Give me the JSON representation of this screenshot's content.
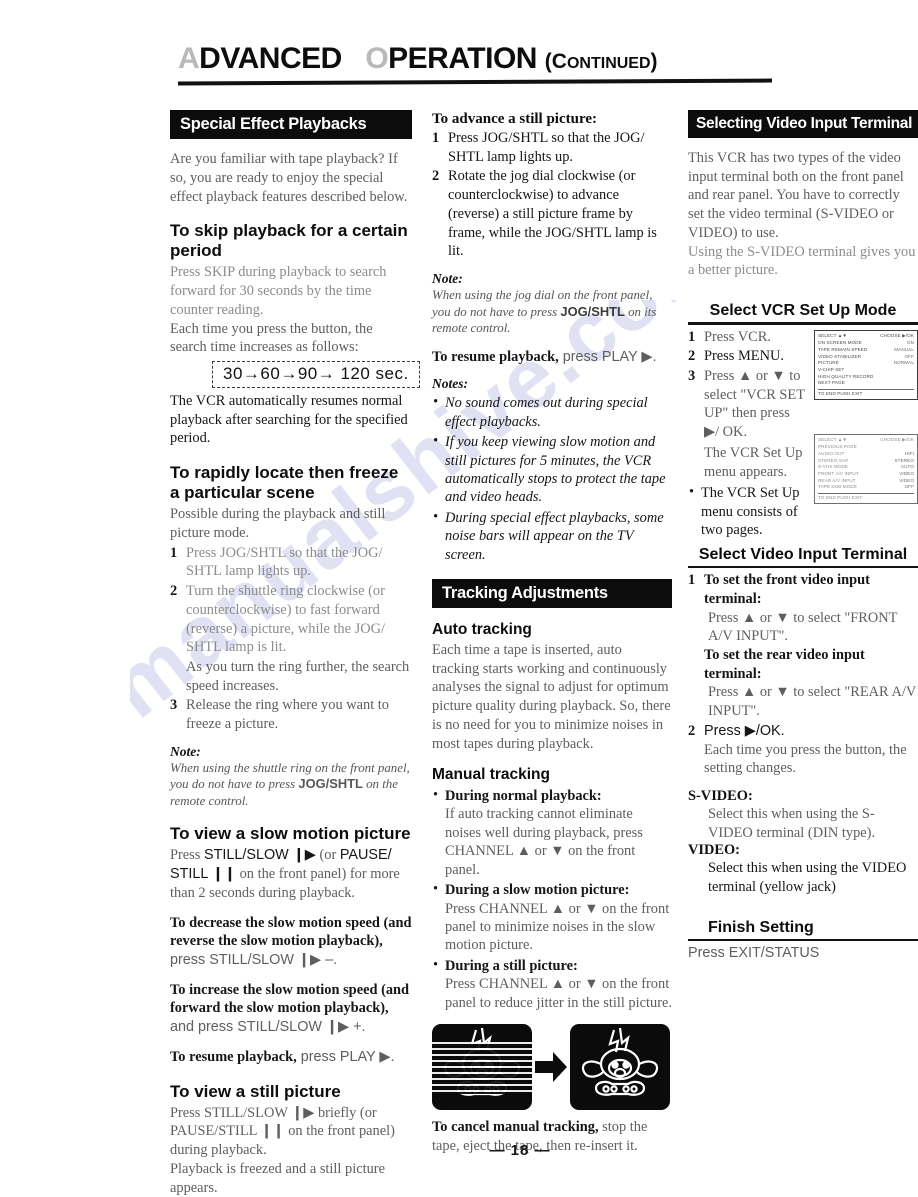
{
  "header": {
    "title_main": "DVANCED",
    "title_faded_a": "A",
    "title_faded_o": "O",
    "title_second": "PERATION",
    "continued_open": "(C",
    "continued_rest": "ONTINUED",
    "continued_close": ")"
  },
  "page_number": "— 18 —",
  "watermark": "manualshive.com",
  "left": {
    "section_title": "Special Effect Playbacks",
    "intro": "Are you familiar with tape playback? If so, you are ready to enjoy the special effect playback features described below.",
    "h_skip": "To skip playback for a certain period",
    "skip_p1": "Press SKIP during playback to search forward for 30 seconds by the time counter reading.",
    "skip_p2": "Each time you press the button, the search time increases as follows:",
    "skip_sequence": "30→60→90→ 120 sec.",
    "skip_p3": "The VCR automatically resumes normal playback after searching for the specified period.",
    "h_freeze": "To rapidly locate then freeze a particular scene",
    "freeze_intro": "Possible during the playback and still picture mode.",
    "freeze_steps": [
      "Press JOG/SHTL so that the JOG/ SHTL lamp lights up.",
      "Turn the shuttle ring clockwise (or counterclockwise) to fast forward (reverse) a picture, while the JOG/ SHTL lamp is lit.",
      "Release the ring where you want to freeze a picture."
    ],
    "freeze_step2_extra": "As you turn the ring further, the search speed increases.",
    "note_label": "Note:",
    "note_text_a": "When using the shuttle ring on the front panel, you do not have to press ",
    "note_text_b": "JOG/SHTL",
    "note_text_c": " on the remote control.",
    "h_slow": "To view a slow motion picture",
    "slow_p1_a": "Press ",
    "slow_p1_b": "STILL/SLOW ❙▶",
    "slow_p1_c": " (or ",
    "slow_p1_d": "PAUSE/ STILL ❙❙",
    "slow_p1_e": " on the front panel) for more than 2 seconds during playback.",
    "decrease_bold": "To decrease the slow motion speed (and reverse the slow motion playback),",
    "decrease_rest": " press STILL/SLOW ❙▶  –.",
    "increase_bold": "To increase the slow motion speed (and forward the slow motion playback),",
    "increase_rest": " and press STILL/SLOW ❙▶  +.",
    "resume_bold": "To resume playback,",
    "resume_rest": " press PLAY ▶.",
    "h_still": "To view a still picture",
    "still_p1": "Press STILL/SLOW ❙▶ briefly (or PAUSE/STILL ❙❙ on the front panel) during playback.",
    "still_p2": "Playback is freezed and a still picture appears."
  },
  "mid": {
    "h_advance": "To advance a still picture:",
    "advance_steps": [
      "Press JOG/SHTL so that the JOG/ SHTL lamp lights up.",
      "Rotate the jog dial clockwise (or counterclockwise) to advance (reverse) a still picture frame by frame, while the JOG/SHTL lamp is lit."
    ],
    "note_label": "Note:",
    "note_text_a": "When using the jog dial on the front panel, you do not have to press ",
    "note_text_b": "JOG/SHTL",
    "note_text_c": " on its remote control.",
    "resume_bold": "To resume playback,",
    "resume_rest": " press PLAY ▶.",
    "notes_label": "Notes:",
    "notes": [
      "No sound comes out during special effect playbacks.",
      "If you keep viewing slow motion and still pictures for 5 minutes, the VCR automatically stops to protect the tape and video heads.",
      "During special effect playbacks, some noise bars will appear on the TV screen."
    ],
    "section_title": "Tracking Adjustments",
    "h_auto": "Auto tracking",
    "auto_p": "Each time a tape is inserted, auto tracking starts working and continuously analyses the signal to adjust for optimum picture quality during playback. So, there is no need for you to minimize noises in most tapes during playback.",
    "h_manual": "Manual tracking",
    "manual_items": [
      {
        "title": "During normal playback:",
        "body": "If auto tracking cannot eliminate noises well during playback, press CHANNEL ▲ or ▼ on the front panel."
      },
      {
        "title": "During a slow motion picture:",
        "body": "Press CHANNEL ▲ or ▼ on the front panel to minimize noises in the slow motion picture."
      },
      {
        "title": "During a still picture:",
        "body": "Press CHANNEL ▲ or ▼ on the front panel to reduce jitter in the still picture."
      }
    ],
    "cancel_bold": "To cancel manual tracking,",
    "cancel_rest": " stop the tape, eject the tape, then re-insert it.",
    "illustration_alt_left": "tv-screen-with-noise-bars",
    "illustration_alt_right": "tv-screen-clean-picture"
  },
  "right": {
    "section_title": "Selecting Video Input Terminal",
    "intro_p1": "This VCR has two types of the video input terminal both on the front panel and rear panel. You have to correctly set the video terminal (S-VIDEO or VIDEO) to use.",
    "intro_p2": "Using the S-VIDEO terminal gives you a better picture.",
    "h_setup": "Select VCR Set Up Mode",
    "setup_steps": [
      "Press VCR.",
      "Press MENU.",
      "Press ▲ or ▼ to select \"VCR SET UP\" then press ▶/ OK."
    ],
    "setup_after": "The VCR Set Up menu appears.",
    "setup_bullet": "The VCR Set Up menu consists of two pages.",
    "osd1": {
      "top_left": "SELECT ▲▼",
      "top_right": "CHOOSE ▶/OK",
      "rows": [
        {
          "label": "ON SCREEN MODE",
          "value": "ON"
        },
        {
          "label": "TAPE REMAIN SPEED",
          "value": "MANUAL"
        },
        {
          "label": "VIDEO STABILIZER",
          "value": "OFF"
        },
        {
          "label": "PICTURE",
          "value": "NORMAL"
        },
        {
          "label": "V-CHIP SET",
          "value": ""
        },
        {
          "label": "HIGH QUALITY RECORD",
          "value": ""
        },
        {
          "label": "NEXT PAGE",
          "value": ""
        }
      ],
      "footer": "TO END PUSH EXIT"
    },
    "osd2": {
      "top_left": "SELECT ▲▼",
      "top_right": "CHOOSE ▶/OK",
      "rows": [
        {
          "label": "PREVIOUS PAGE",
          "value": ""
        },
        {
          "label": "AUDIO OUT",
          "value": "HIFI"
        },
        {
          "label": "STEREO SAP",
          "value": "STEREO"
        },
        {
          "label": "S-VHS MODE",
          "value": "AUTO"
        },
        {
          "label": "FRONT A/V INPUT",
          "value": "VIDEO"
        },
        {
          "label": "REAR A/V INPUT",
          "value": "VIDEO"
        },
        {
          "label": "TAPE DUB MODE",
          "value": "OFF"
        }
      ],
      "footer": "TO END PUSH EXIT"
    },
    "h_select_terminal": "Select Video Input Terminal",
    "term_step1_title": "To set the front video input terminal:",
    "term_step1_body": "Press ▲ or ▼ to select \"FRONT A/V INPUT\".",
    "term_step1_title2": "To set the rear video input terminal:",
    "term_step1_body2": "Press ▲ or ▼ to select \"REAR A/V INPUT\".",
    "term_step2": "Press ▶/OK.",
    "term_step2_body": "Each time you press the button, the setting changes.",
    "svideo_label": "S-VIDEO:",
    "svideo_body": "Select this when using the S-VIDEO terminal (DIN type).",
    "video_label": "VIDEO:",
    "video_body": "Select this when using the VIDEO terminal (yellow jack)",
    "h_finish": "Finish Setting",
    "finish_body": "Press EXIT/STATUS"
  }
}
